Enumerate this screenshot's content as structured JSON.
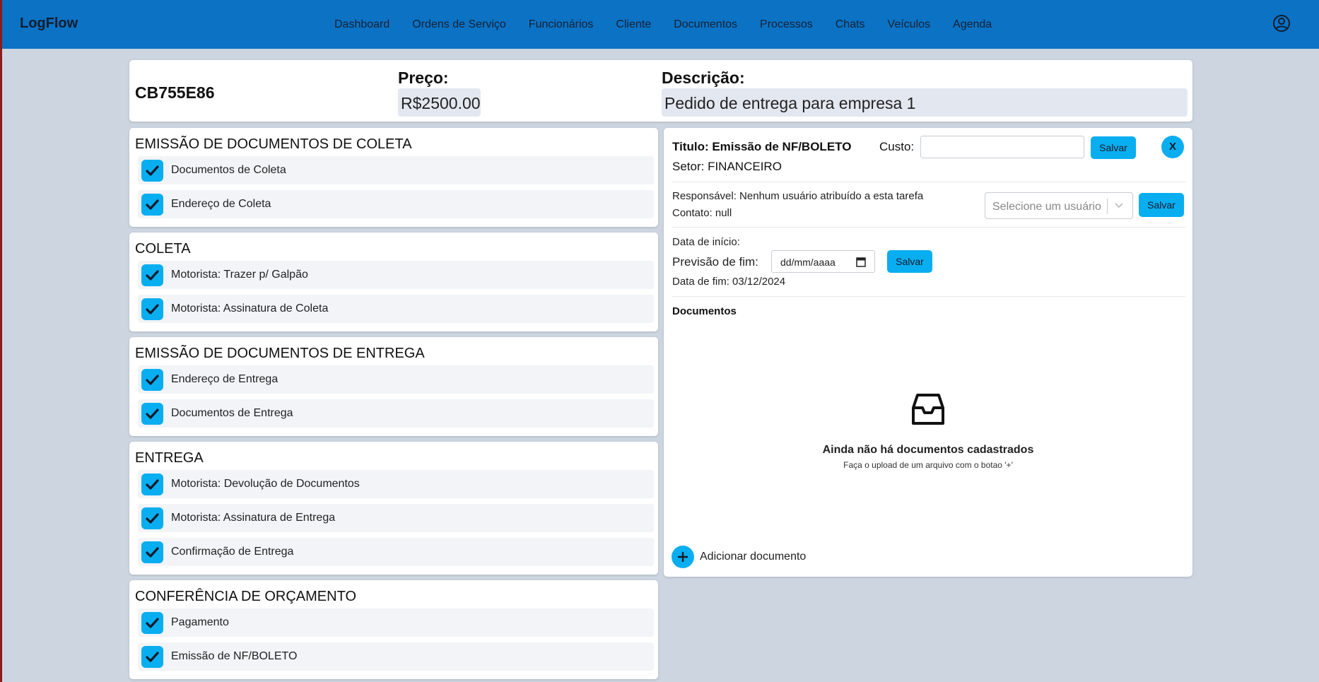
{
  "app": {
    "brand": "LogFlow"
  },
  "nav": {
    "links": [
      "Dashboard",
      "Ordens de Serviço",
      "Funcionários",
      "Cliente",
      "Documentos",
      "Processos",
      "Chats",
      "Veículos",
      "Agenda"
    ],
    "user_icon": "user-circle-icon"
  },
  "order": {
    "code": "CB755E86",
    "price_label": "Preço:",
    "price_value": "R$2500.00",
    "description_label": "Descrição:",
    "description_value": "Pedido de entrega para empresa 1"
  },
  "sections": [
    {
      "title": "EMISSÃO DE DOCUMENTOS DE COLETA",
      "tasks": [
        "Documentos de Coleta",
        "Endereço de Coleta"
      ]
    },
    {
      "title": "COLETA",
      "tasks": [
        "Motorista: Trazer p/ Galpão",
        "Motorista: Assinatura de Coleta"
      ]
    },
    {
      "title": "EMISSÃO DE DOCUMENTOS DE ENTREGA",
      "tasks": [
        "Endereço de Entrega",
        "Documentos de Entrega"
      ]
    },
    {
      "title": "ENTREGA",
      "tasks": [
        "Motorista: Devolução de Documentos",
        "Motorista: Assinatura de Entrega",
        "Confirmação de Entrega"
      ]
    },
    {
      "title": "CONFERÊNCIA DE ORÇAMENTO",
      "tasks": [
        "Pagamento",
        "Emissão de NF/BOLETO"
      ]
    }
  ],
  "task_detail": {
    "title": "Titulo: Emissão de NF/BOLETO",
    "setor": "Setor: FINANCEIRO",
    "custo_label": "Custo:",
    "custo_value": "",
    "save_label": "Salvar",
    "close_label": "X",
    "responsavel": "Responsável: Nenhum usuário atribuído a esta tarefa",
    "contato": "Contato: null",
    "select_placeholder": "Selecione um usuário",
    "data_inicio": "Data de início:",
    "previsao_label": "Previsão de fim:",
    "date_placeholder": "dd/mm/aaaa",
    "data_fim": "Data de fim: 03/12/2024",
    "documentos_label": "Documentos",
    "empty_title": "Ainda não há documentos cadastrados",
    "empty_sub": "Faça o upload de um arquivo com o botao '+'",
    "add_doc_label": "Adicionar documento"
  },
  "colors": {
    "nav": "#0b72c4",
    "accent": "#08aef0",
    "background": "#ccd5e0"
  }
}
